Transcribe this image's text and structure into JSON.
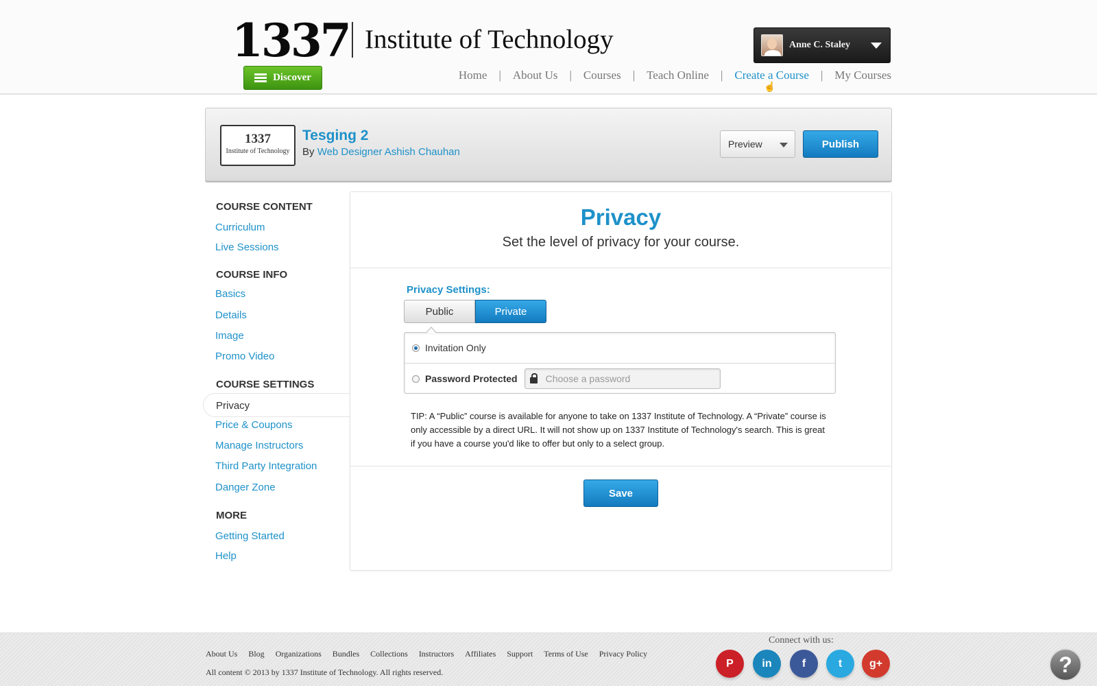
{
  "header": {
    "logo_number": "1337",
    "logo_text": "Institute of Technology",
    "discover_label": "Discover",
    "user_name": "Anne C. Staley",
    "nav": [
      {
        "label": "Home"
      },
      {
        "label": "About Us"
      },
      {
        "label": "Courses"
      },
      {
        "label": "Teach Online"
      },
      {
        "label": "Create a Course"
      },
      {
        "label": "My Courses"
      }
    ],
    "nav_active_color": "#1e91c9"
  },
  "course": {
    "logo_number": "1337",
    "logo_text": "Institute of Technology",
    "title": "Tesging 2",
    "by_prefix": "By",
    "author": "Web Designer Ashish Chauhan",
    "preview_label": "Preview",
    "publish_label": "Publish"
  },
  "sidebar": {
    "content_heading": "COURSE CONTENT",
    "content_items": [
      "Curriculum",
      "Live Sessions"
    ],
    "info_heading": "COURSE INFO",
    "info_items": [
      "Basics",
      "Details",
      "Image",
      "Promo Video"
    ],
    "settings_heading": "COURSE SETTINGS",
    "active_item": "Privacy",
    "settings_items": [
      "Price & Coupons",
      "Manage Instructors",
      "Third Party Integration",
      "Danger Zone"
    ],
    "more_heading": "MORE",
    "more_items": [
      "Getting Started",
      "Help"
    ]
  },
  "main": {
    "title": "Privacy",
    "subtitle": "Set the level of privacy for your course.",
    "settings_label": "Privacy Settings:",
    "toggle_public": "Public",
    "toggle_private": "Private",
    "selected_toggle": "Private",
    "option_invitation": "Invitation Only",
    "option_password": "Password Protected",
    "selected_option": "Invitation Only",
    "password_placeholder": "Choose a password",
    "tip": "TIP: A “Public” course is available for anyone to take on 1337 Institute of Technology. A “Private” course is only accessible by a direct URL. It will not show up on 1337 Institute of Technology's search. This is great if you have a course you'd like to offer but only to a select group.",
    "save_label": "Save"
  },
  "footer": {
    "links": [
      "About Us",
      "Blog",
      "Organizations",
      "Bundles",
      "Collections",
      "Instructors",
      "Affiliates",
      "Support",
      "Terms of Use",
      "Privacy Policy"
    ],
    "copyright": "All content © 2013 by 1337 Institute of Technology. All rights reserved.",
    "connect_label": "Connect with us:",
    "social": [
      {
        "name": "pinterest-icon",
        "glyph": "P",
        "color": "#cb2027"
      },
      {
        "name": "linkedin-icon",
        "glyph": "in",
        "color": "#1b86bc"
      },
      {
        "name": "facebook-icon",
        "glyph": "f",
        "color": "#3b5998"
      },
      {
        "name": "twitter-icon",
        "glyph": "t",
        "color": "#2aa9e0"
      },
      {
        "name": "google-plus-icon",
        "glyph": "g+",
        "color": "#d23a2e"
      }
    ],
    "help_glyph": "?"
  },
  "colors": {
    "brand_blue": "#1e91c9",
    "discover_green": "#4aa51a"
  }
}
